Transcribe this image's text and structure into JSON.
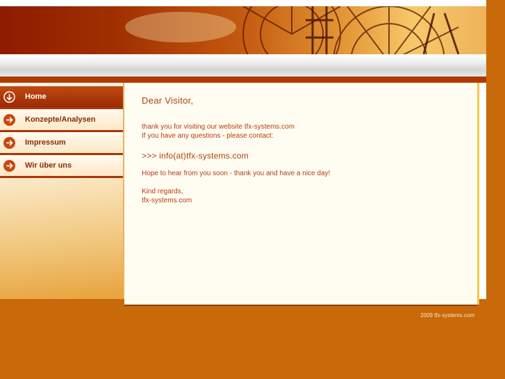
{
  "nav": {
    "items": [
      {
        "label": "Home",
        "icon": "chevron-down-circle-icon",
        "active": true
      },
      {
        "label": "Konzepte/Analysen",
        "icon": "chevron-right-circle-icon",
        "active": false
      },
      {
        "label": "Impressum",
        "icon": "chevron-right-circle-icon",
        "active": false
      },
      {
        "label": "Wir über uns",
        "icon": "chevron-right-circle-icon",
        "active": false
      }
    ]
  },
  "content": {
    "greeting": "Dear Visitor,",
    "line1": "thank you for visiting our website tfx-systems.com",
    "line2": "If you have any questions - please contact:",
    "contact": ">>> info(at)tfx-systems.com",
    "line3": "Hope to hear from you soon - thank you and have a nice day!",
    "line4": "Kind regards,",
    "line5": "tfx-systems.com"
  },
  "footer": {
    "text": "2009 tfx-systems.com"
  },
  "colors": {
    "page_background": "#c8690a",
    "text": "#b23e0c",
    "nav_active": "#9a2c05",
    "content_background": "#fffdf1"
  }
}
